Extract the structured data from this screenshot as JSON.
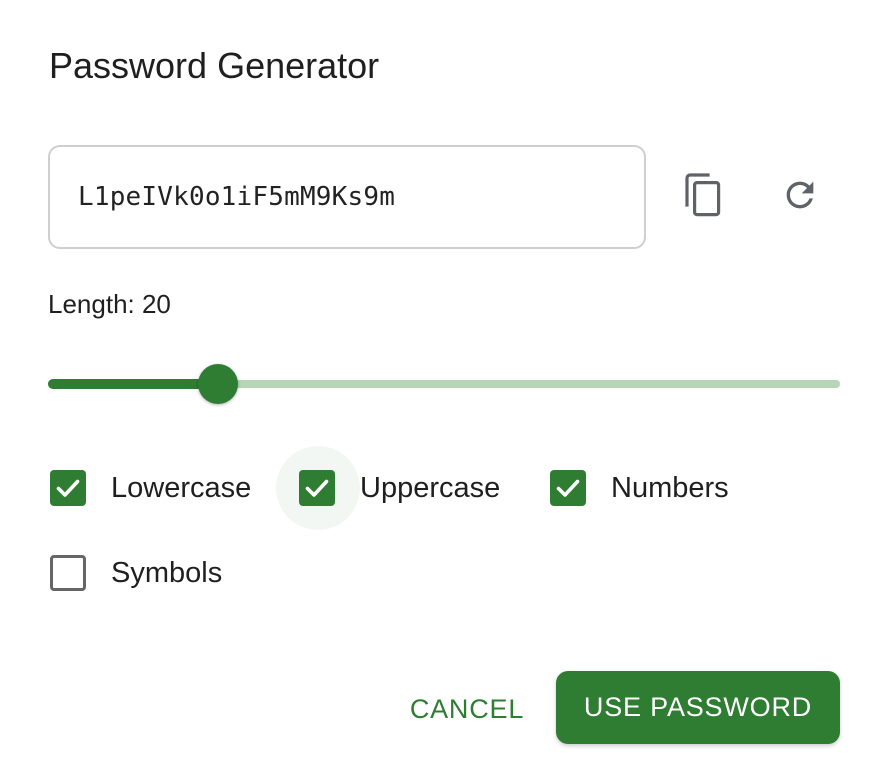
{
  "dialog": {
    "title": "Password Generator"
  },
  "password": {
    "value": "L1peIVk0o1iF5mM9Ks9m"
  },
  "icons": {
    "copy": "copy-icon",
    "refresh": "refresh-icon",
    "check": "check-icon"
  },
  "length": {
    "label": "Length: 20",
    "value": 20,
    "slider_fraction": 0.215
  },
  "options": {
    "lowercase": {
      "label": "Lowercase",
      "checked": true
    },
    "uppercase": {
      "label": "Uppercase",
      "checked": true
    },
    "numbers": {
      "label": "Numbers",
      "checked": true
    },
    "symbols": {
      "label": "Symbols",
      "checked": false
    }
  },
  "actions": {
    "cancel_label": "CANCEL",
    "use_label": "USE PASSWORD"
  },
  "colors": {
    "accent": "#2e7d32",
    "track": "#b6d6b8"
  }
}
